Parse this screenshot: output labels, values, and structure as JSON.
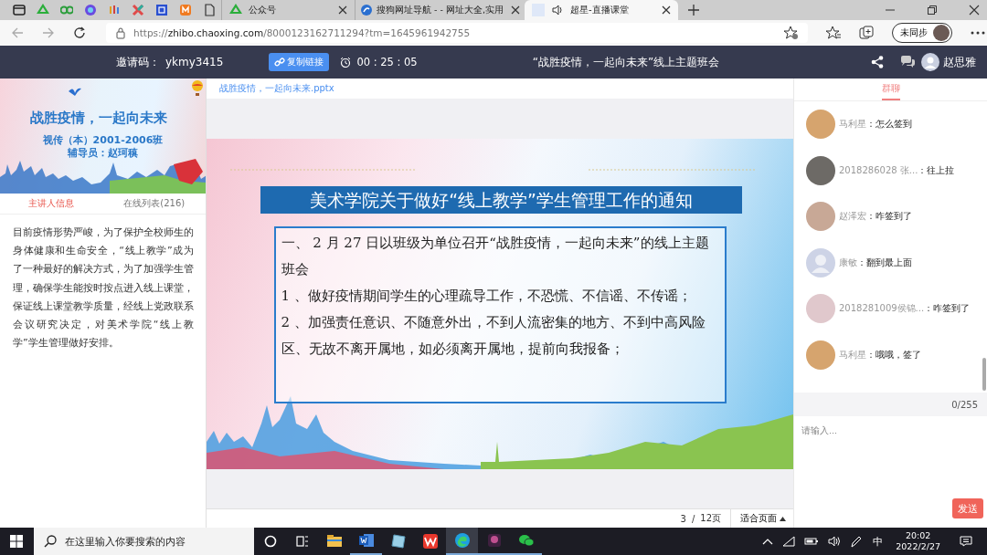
{
  "browser": {
    "tabs": [
      {
        "title": "公众号",
        "selected": false
      },
      {
        "title": "搜狗网址导航 - - 网址大全,实用",
        "selected": false
      },
      {
        "title": "超星-直播课堂",
        "selected": true
      }
    ],
    "url": {
      "scheme": "https://",
      "domain": "zhibo.chaoxing.com",
      "path": "/8000123162711294?tm=1645961942755"
    },
    "sync_button": "未同步"
  },
  "header": {
    "invite_label": "邀请码：",
    "invite_code": "ykmy3415",
    "copy_button": "复制链接",
    "timer": "00 : 25 : 05",
    "title": "“战胜疫情，一起向未来”线上主题班会",
    "user": "赵思雅"
  },
  "left": {
    "banner": {
      "title": "战胜疫情，一起向未来",
      "class_name": "视传（本）2001-2006班",
      "counselor": "辅导员：赵珂稹"
    },
    "tabs": [
      {
        "label": "主讲人信息",
        "selected": true
      },
      {
        "label": "在线列表(216)",
        "selected": false
      }
    ],
    "intro": "目前疫情形势严峻，为了保护全校师生的身体健康和生命安全，“线上教学”成为了一种最好的解决方式，为了加强学生管理，确保学生能按时按点进入线上课堂，保证线上课堂教学质量，经线上党政联系会议研究决定，对美术学院“线上教学”学生管理做好安排。"
  },
  "document": {
    "file_name": "战胜疫情，一起向未来.pptx",
    "slide": {
      "title": "美术学院关于做好“线上教学”学生管理工作的通知",
      "lines": [
        "一、 2 月 27 日以班级为单位召开“战胜疫情，一起向未来”的线上主题班会",
        "1 、做好疫情期间学生的心理疏导工作，不恐慌、不信谣、不传谣；",
        "2 、加强责任意识、不随意外出，不到人流密集的地方、不到中高风险区、无故不离开属地，如必须离开属地，提前向我报备；"
      ]
    },
    "page": "3",
    "separator": "/",
    "pages": "12页",
    "zoom_button": "适合页面"
  },
  "chat": {
    "tabs": [
      {
        "label": "群聊",
        "selected": true
      }
    ],
    "messages": [
      {
        "kind": "photo",
        "name": "马利星",
        "colon": "：",
        "text": "怎么签到"
      },
      {
        "kind": "photo",
        "name": "2018286028 张...",
        "colon": "：",
        "text": "往上拉"
      },
      {
        "kind": "photo",
        "name": "赵泽宏",
        "colon": "：",
        "text": "咋签到了"
      },
      {
        "kind": "default",
        "name": "康敏",
        "colon": "：",
        "text": "翻到最上面"
      },
      {
        "kind": "photo",
        "name": "2018281009侯锦...",
        "colon": "：",
        "text": "咋签到了"
      },
      {
        "kind": "photo",
        "name": "马利星",
        "colon": "：",
        "text": "哦哦，签了"
      }
    ],
    "counter": "0/255",
    "input": {
      "placeholder": "请输入..."
    },
    "send_button": "发送"
  },
  "taskbar": {
    "search": {
      "placeholder": "在这里输入你要搜索的内容"
    },
    "apps": [
      {
        "kind": "explorer",
        "running": false,
        "selected": false
      },
      {
        "kind": "word",
        "running": true,
        "selected": false
      },
      {
        "kind": "notes",
        "running": false,
        "selected": false
      },
      {
        "kind": "wps",
        "running": false,
        "selected": false
      },
      {
        "kind": "edge",
        "running": true,
        "selected": true
      },
      {
        "kind": "game",
        "running": true,
        "selected": false
      },
      {
        "kind": "wechat",
        "running": true,
        "selected": false
      }
    ],
    "ime": "中",
    "time": "20:02",
    "date": "2022/2/27"
  }
}
